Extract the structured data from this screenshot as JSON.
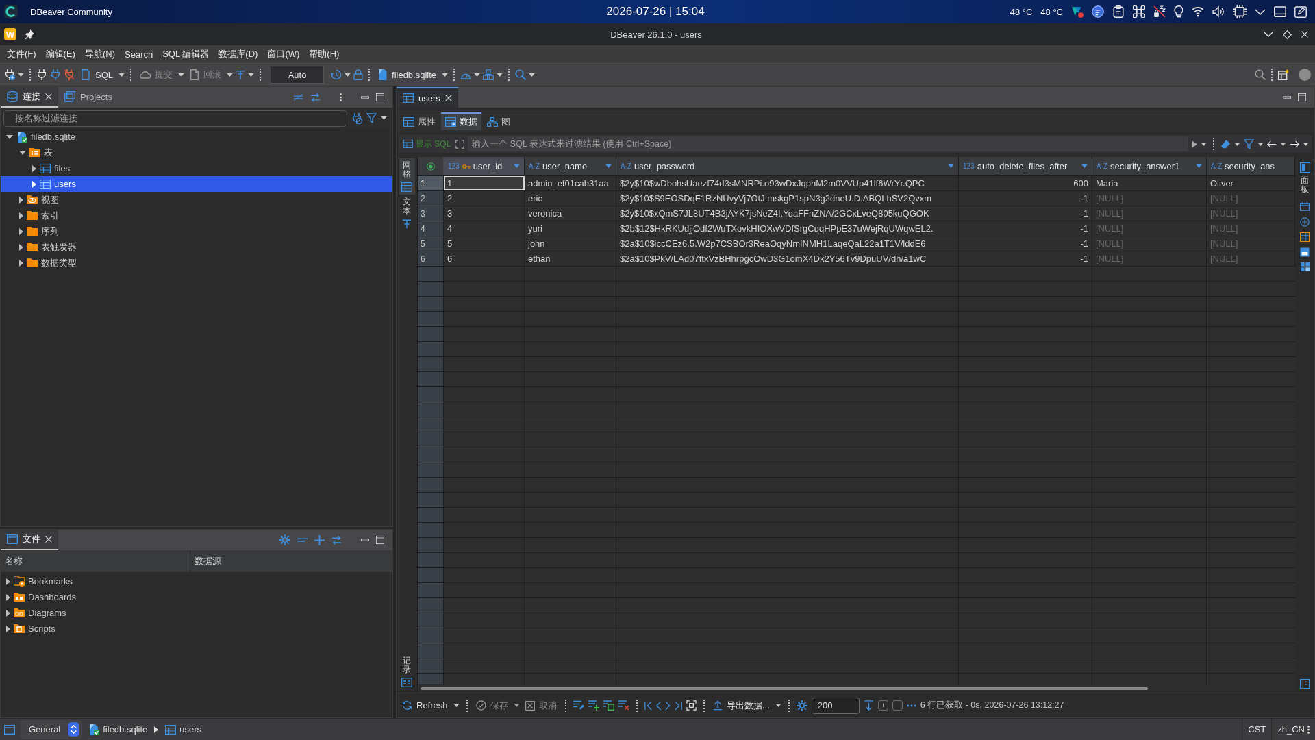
{
  "os_bar": {
    "app_name": "DBeaver Community",
    "clock": "2026-07-26 | 15:04",
    "temperatures": [
      "48 °C",
      "48 °C"
    ]
  },
  "window": {
    "app_badge": "W",
    "title": "DBeaver 26.1.0 - users"
  },
  "menu": [
    "文件(F)",
    "编辑(E)",
    "导航(N)",
    "Search",
    "SQL 编辑器",
    "数据库(D)",
    "窗口(W)",
    "帮助(H)"
  ],
  "toolbar": [
    {
      "kind": "sql",
      "label": "SQL",
      "disabled": false
    },
    {
      "kind": "commit",
      "label": "提交",
      "disabled": true
    },
    {
      "kind": "rollback",
      "label": "回滚",
      "disabled": true
    },
    {
      "kind": "mode",
      "label": "Auto",
      "disabled": false
    },
    {
      "kind": "connection",
      "label": "filedb.sqlite",
      "disabled": false
    }
  ],
  "navigator": {
    "tabs": [
      {
        "label": "连接",
        "selected": true
      },
      {
        "label": "Projects",
        "selected": false
      }
    ],
    "filter": {
      "placeholder": "按名称过滤连接"
    },
    "tree": [
      {
        "label": "filedb.sqlite",
        "kind": "connection",
        "expanded": true,
        "selected": false,
        "children": [
          {
            "label": "表",
            "kind": "tables",
            "expanded": true,
            "selected": false,
            "children": [
              {
                "label": "files",
                "kind": "table",
                "expanded": false,
                "selected": false
              },
              {
                "label": "users",
                "kind": "table",
                "expanded": false,
                "selected": true
              }
            ]
          },
          {
            "label": "视图",
            "kind": "views",
            "expanded": false,
            "selected": false
          },
          {
            "label": "索引",
            "kind": "folder",
            "expanded": false,
            "selected": false
          },
          {
            "label": "序列",
            "kind": "folder",
            "expanded": false,
            "selected": false
          },
          {
            "label": "表触发器",
            "kind": "folder",
            "expanded": false,
            "selected": false
          },
          {
            "label": "数据类型",
            "kind": "folder",
            "expanded": false,
            "selected": false
          }
        ]
      }
    ]
  },
  "files_panel": {
    "tabs": [
      {
        "label": "文件",
        "selected": true
      }
    ],
    "columns": [
      "名称",
      "数据源"
    ],
    "items": [
      {
        "label": "Bookmarks",
        "kind": "bookmarks",
        "expanded": false
      },
      {
        "label": "Dashboards",
        "kind": "dashboards",
        "expanded": false
      },
      {
        "label": "Diagrams",
        "kind": "diagrams",
        "expanded": false
      },
      {
        "label": "Scripts",
        "kind": "scripts",
        "expanded": false
      }
    ]
  },
  "editor": {
    "tabs": [
      {
        "label": "users",
        "selected": true
      }
    ],
    "views": [
      {
        "label": "属性",
        "kind": "properties",
        "selected": false
      },
      {
        "label": "数据",
        "kind": "data",
        "selected": true
      },
      {
        "label": "图",
        "kind": "diagram",
        "selected": false
      }
    ],
    "filter": {
      "sql_button": "显示 SQL",
      "placeholder": "输入一个 SQL 表达式来过滤结果 (使用 Ctrl+Space)"
    },
    "side_tabs": [
      {
        "label": "网格",
        "kind": "grid",
        "selected": true
      },
      {
        "label": "文本",
        "kind": "text",
        "selected": false
      }
    ],
    "record_tab": "记录",
    "panels_tab": "面板",
    "grid": {
      "columns": [
        {
          "name": "user_id",
          "type_label": "123",
          "kind": "key"
        },
        {
          "name": "user_name",
          "type_label": "A-Z",
          "kind": "text"
        },
        {
          "name": "user_password",
          "type_label": "A-Z",
          "kind": "text"
        },
        {
          "name": "auto_delete_files_after",
          "type_label": "123",
          "kind": "number"
        },
        {
          "name": "security_answer1",
          "type_label": "A-Z",
          "kind": "text"
        },
        {
          "name": "security_ans",
          "type_label": "A-Z",
          "kind": "text"
        }
      ],
      "rows": [
        {
          "number": "1",
          "selected": true,
          "cells": [
            {
              "value": "1",
              "null": false
            },
            {
              "value": "admin_ef01cab31aa",
              "null": false
            },
            {
              "value": "$2y$10$wDbohsUaezf74d3sMNRPi.o93wDxJqphM2m0VVUp41lf6WrYr.QPC",
              "null": false
            },
            {
              "value": "600",
              "null": false
            },
            {
              "value": "Maria",
              "null": false
            },
            {
              "value": "Oliver",
              "null": false
            }
          ]
        },
        {
          "number": "2",
          "selected": false,
          "cells": [
            {
              "value": "2",
              "null": false
            },
            {
              "value": "eric",
              "null": false
            },
            {
              "value": "$2y$10$S9EOSDqF1RzNUvyVj7OtJ.mskgP1spN3g2dneU.D.ABQLhSV2Qvxm",
              "null": false
            },
            {
              "value": "-1",
              "null": false
            },
            {
              "value": "[NULL]",
              "null": true
            },
            {
              "value": "[NULL]",
              "null": true
            }
          ]
        },
        {
          "number": "3",
          "selected": false,
          "cells": [
            {
              "value": "3",
              "null": false
            },
            {
              "value": "veronica",
              "null": false
            },
            {
              "value": "$2y$10$xQmS7JL8UT4B3jAYK7jsNeZ4I.YqaFFnZNA/2GCxLveQ805kuQGOK",
              "null": false
            },
            {
              "value": "-1",
              "null": false
            },
            {
              "value": "[NULL]",
              "null": true
            },
            {
              "value": "[NULL]",
              "null": true
            }
          ]
        },
        {
          "number": "4",
          "selected": false,
          "cells": [
            {
              "value": "4",
              "null": false
            },
            {
              "value": "yuri",
              "null": false
            },
            {
              "value": "$2b$12$HkRKUdjjOdf2WuTXovkHIOXwVDfSrgCqqHPpE37uWejRqUWqwEL2.",
              "null": false
            },
            {
              "value": "-1",
              "null": false
            },
            {
              "value": "[NULL]",
              "null": true
            },
            {
              "value": "[NULL]",
              "null": true
            }
          ]
        },
        {
          "number": "5",
          "selected": false,
          "cells": [
            {
              "value": "5",
              "null": false
            },
            {
              "value": "john",
              "null": false
            },
            {
              "value": "$2a$10$iccCEz6.5.W2p7CSBOr3ReaOqyNmINMH1LaqeQaL22a1T1V/lddE6",
              "null": false
            },
            {
              "value": "-1",
              "null": false
            },
            {
              "value": "[NULL]",
              "null": true
            },
            {
              "value": "[NULL]",
              "null": true
            }
          ]
        },
        {
          "number": "6",
          "selected": false,
          "cells": [
            {
              "value": "6",
              "null": false
            },
            {
              "value": "ethan",
              "null": false
            },
            {
              "value": "$2a$10$PkV/LAd07ftxVzBHhrpgcOwD3G1omX4Dk2Y56Tv9DpuUV/dh/a1wC",
              "null": false
            },
            {
              "value": "-1",
              "null": false
            },
            {
              "value": "[NULL]",
              "null": true
            },
            {
              "value": "[NULL]",
              "null": true
            }
          ]
        }
      ]
    }
  },
  "results_toolbar": {
    "refresh": "Refresh",
    "save": {
      "label": "保存",
      "disabled": true
    },
    "cancel": {
      "label": "取消",
      "disabled": true
    },
    "export": "导出数据...",
    "fetch_size": "200",
    "status": "6 行已获取 - 0s, 2026-07-26 13:12:27"
  },
  "status_bar": {
    "perspective": "General",
    "breadcrumb": [
      {
        "label": "filedb.sqlite",
        "kind": "connection"
      },
      {
        "label": "users",
        "kind": "table"
      }
    ],
    "timezone": "CST",
    "locale": "zh_CN"
  }
}
